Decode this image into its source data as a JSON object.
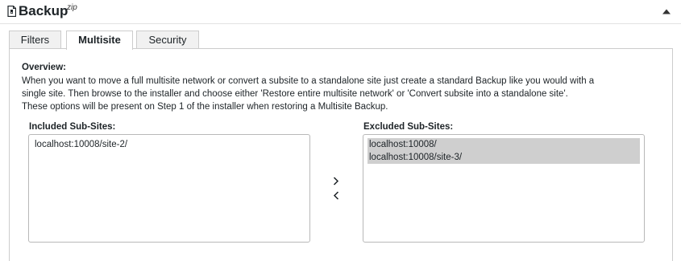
{
  "header": {
    "title": "Backup",
    "badge": "zip"
  },
  "tabs": [
    {
      "label": "Filters",
      "active": false
    },
    {
      "label": "Multisite",
      "active": true
    },
    {
      "label": "Security",
      "active": false
    }
  ],
  "overview": {
    "title": "Overview:",
    "lines": [
      "When you want to move a full multisite network or convert a subsite to a standalone site just create a standard Backup like you would with a",
      "single site. Then browse to the installer and choose either 'Restore entire multisite network' or 'Convert subsite into a standalone site'.",
      "These options will be present on Step 1 of the installer when restoring a Multisite Backup."
    ]
  },
  "included": {
    "label": "Included Sub-Sites:",
    "items": [
      "localhost:10008/site-2/"
    ]
  },
  "excluded": {
    "label": "Excluded Sub-Sites:",
    "items": [
      "localhost:10008/",
      "localhost:10008/site-3/"
    ]
  },
  "icons": {
    "header": "archive-file-icon",
    "collapse": "caret-up-icon",
    "move_right": "chevron-right-icon",
    "move_left": "chevron-left-icon"
  },
  "colors": {
    "selected_option_bg": "#cfcfcf",
    "text": "#1d2327",
    "border": "#cccccc"
  }
}
